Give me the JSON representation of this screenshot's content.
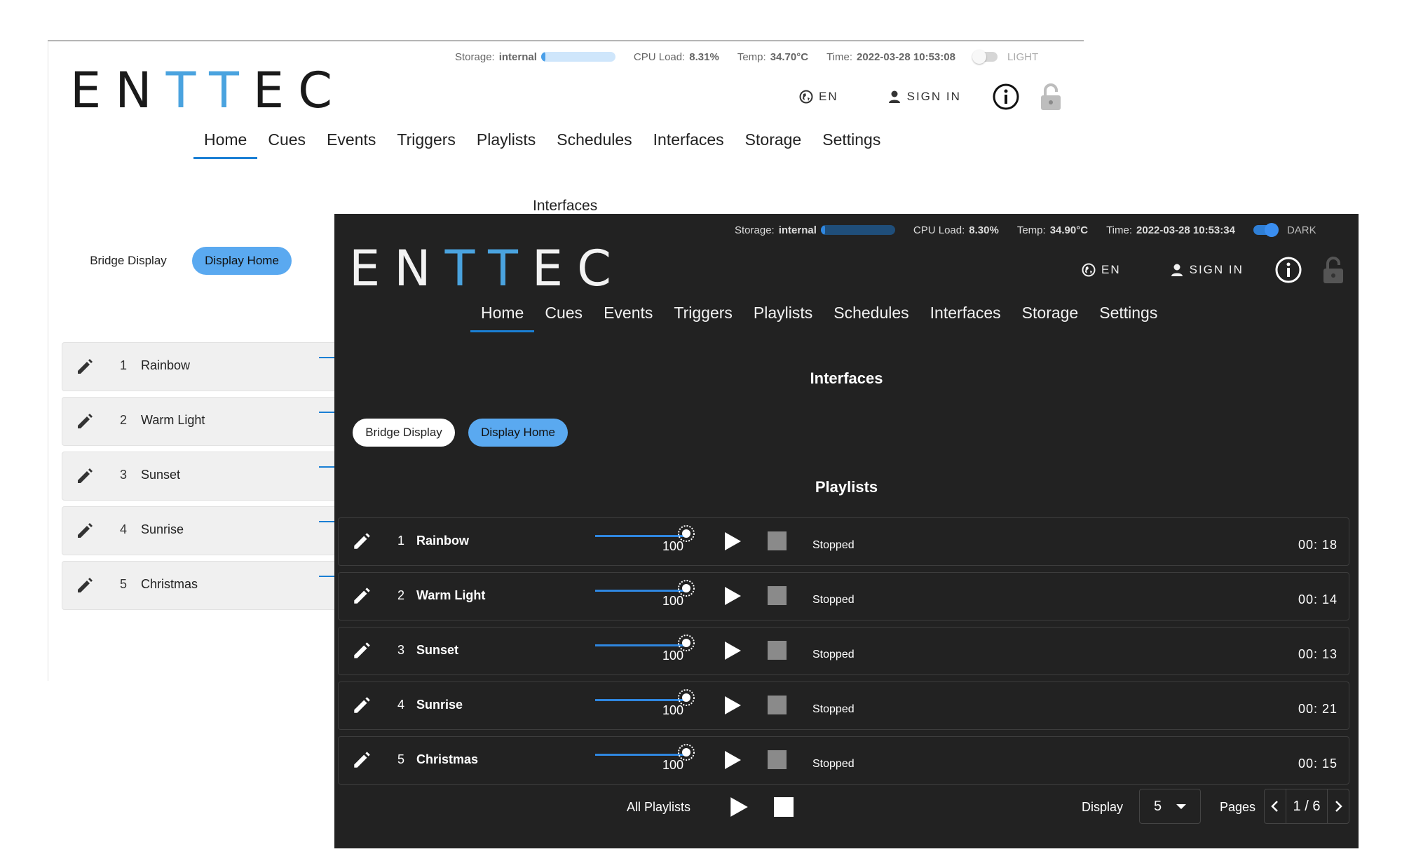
{
  "light": {
    "status": {
      "storage_label": "Storage:",
      "storage_value": "internal",
      "storage_fill": 0.05,
      "cpu_label": "CPU Load:",
      "cpu_value": "8.31%",
      "temp_label": "Temp:",
      "temp_value": "34.70°C",
      "time_label": "Time:",
      "time_value": "2022-03-28 10:53:08",
      "theme_label": "LIGHT"
    },
    "logo": {
      "prefix": "EN",
      "middle": "TT",
      "suffix": "EC"
    },
    "header": {
      "language": "EN",
      "sign_in": "SIGN IN"
    },
    "nav": [
      "Home",
      "Cues",
      "Events",
      "Triggers",
      "Playlists",
      "Schedules",
      "Interfaces",
      "Storage",
      "Settings"
    ],
    "section_title": "Interfaces",
    "interface_tabs": [
      "Bridge Display",
      "Display Home"
    ],
    "rows": [
      {
        "num": "1",
        "name": "Rainbow"
      },
      {
        "num": "2",
        "name": "Warm Light"
      },
      {
        "num": "3",
        "name": "Sunset"
      },
      {
        "num": "4",
        "name": "Sunrise"
      },
      {
        "num": "5",
        "name": "Christmas"
      }
    ]
  },
  "dark": {
    "status": {
      "storage_label": "Storage:",
      "storage_value": "internal",
      "storage_fill": 0.05,
      "cpu_label": "CPU Load:",
      "cpu_value": "8.30%",
      "temp_label": "Temp:",
      "temp_value": "34.90°C",
      "time_label": "Time:",
      "time_value": "2022-03-28 10:53:34",
      "theme_label": "DARK"
    },
    "logo": {
      "prefix": "EN",
      "middle": "TT",
      "suffix": "EC"
    },
    "header": {
      "language": "EN",
      "sign_in": "SIGN IN"
    },
    "nav": [
      "Home",
      "Cues",
      "Events",
      "Triggers",
      "Playlists",
      "Schedules",
      "Interfaces",
      "Storage",
      "Settings"
    ],
    "section_title": "Interfaces",
    "interface_tabs": [
      "Bridge Display",
      "Display Home"
    ],
    "playlists_title": "Playlists",
    "rows": [
      {
        "num": "1",
        "name": "Rainbow",
        "level": "100",
        "state": "Stopped",
        "time": "00: 18"
      },
      {
        "num": "2",
        "name": "Warm Light",
        "level": "100",
        "state": "Stopped",
        "time": "00: 14"
      },
      {
        "num": "3",
        "name": "Sunset",
        "level": "100",
        "state": "Stopped",
        "time": "00: 13"
      },
      {
        "num": "4",
        "name": "Sunrise",
        "level": "100",
        "state": "Stopped",
        "time": "00: 21"
      },
      {
        "num": "5",
        "name": "Christmas",
        "level": "100",
        "state": "Stopped",
        "time": "00: 15"
      }
    ],
    "footer": {
      "all_playlists": "All Playlists",
      "display_label": "Display",
      "display_value": "5",
      "pages_label": "Pages",
      "pages_value": "1 / 6"
    }
  },
  "colors": {
    "accent": "#1a7fd4",
    "pill": "#5aa9f0",
    "logo_t": "#4aa3df",
    "dark_bg": "#222222"
  },
  "icons": [
    "globe-icon",
    "person-icon",
    "info-icon",
    "lock-icon",
    "pencil-icon",
    "sun-icon",
    "play-icon",
    "stop-icon",
    "chevron-left-icon",
    "chevron-right-icon",
    "caret-down-icon"
  ]
}
